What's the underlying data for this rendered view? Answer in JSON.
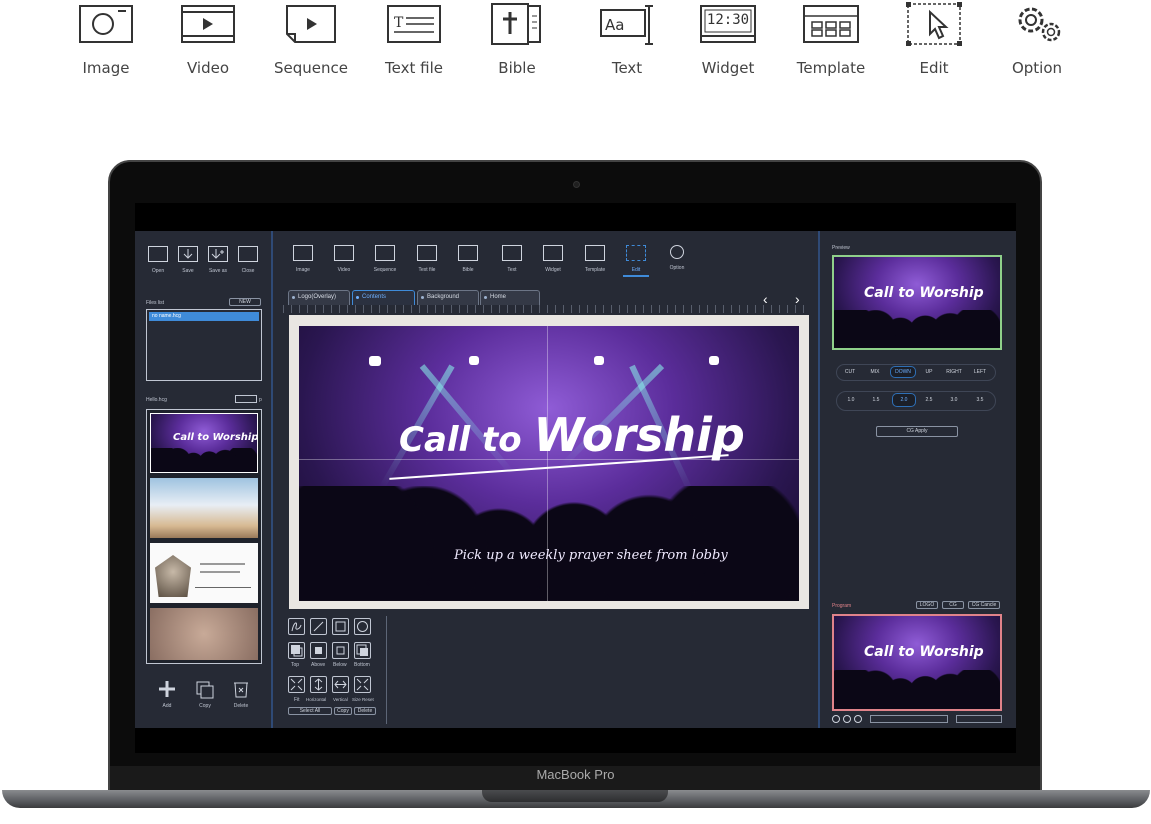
{
  "features": [
    {
      "label": "Image",
      "icon": "image-icon"
    },
    {
      "label": "Video",
      "icon": "video-icon"
    },
    {
      "label": "Sequence",
      "icon": "sequence-icon"
    },
    {
      "label": "Text file",
      "icon": "text-file-icon"
    },
    {
      "label": "Bible",
      "icon": "bible-icon"
    },
    {
      "label": "Text",
      "icon": "text-icon"
    },
    {
      "label": "Widget",
      "icon": "widget-icon",
      "clock": "12:30"
    },
    {
      "label": "Template",
      "icon": "template-icon"
    },
    {
      "label": "Edit",
      "icon": "edit-icon"
    },
    {
      "label": "Option",
      "icon": "option-icon"
    }
  ],
  "laptop": {
    "brand": "MacBook Pro"
  },
  "app": {
    "file_toolbar": [
      {
        "label": "Open"
      },
      {
        "label": "Save"
      },
      {
        "label": "Save as"
      },
      {
        "label": "Close"
      }
    ],
    "files_list": {
      "title": "Files list",
      "new_button": "NEW",
      "selected_file": "no name.hcg"
    },
    "current_file": {
      "name": "Hello.hcg",
      "page_suffix": "p"
    },
    "slide_actions": [
      {
        "label": "Add"
      },
      {
        "label": "Copy"
      },
      {
        "label": "Delete"
      }
    ],
    "main_toolbar": [
      {
        "label": "Image"
      },
      {
        "label": "Video"
      },
      {
        "label": "Sequence"
      },
      {
        "label": "Text file"
      },
      {
        "label": "Bible"
      },
      {
        "label": "Text"
      },
      {
        "label": "Widget"
      },
      {
        "label": "Template"
      },
      {
        "label": "Edit"
      },
      {
        "label": "Option"
      }
    ],
    "active_tool": "Edit",
    "tabs": [
      {
        "label": "Logo(Overlay)",
        "active": false
      },
      {
        "label": "Contents",
        "active": true
      },
      {
        "label": "Background",
        "active": false
      },
      {
        "label": "Home",
        "active": false
      }
    ],
    "slide": {
      "title_part1": "Call to",
      "title_part2": "Worship",
      "subtitle": "Pick up a weekly prayer sheet from lobby"
    },
    "arrange_buttons": [
      {
        "label": "Top"
      },
      {
        "label": "Above"
      },
      {
        "label": "Below"
      },
      {
        "label": "Bottom"
      }
    ],
    "transform_buttons": [
      {
        "label": "Fit"
      },
      {
        "label": "Horizontal"
      },
      {
        "label": "Vertical"
      },
      {
        "label": "Size Reset"
      }
    ],
    "edit_actions": [
      {
        "label": "Select All"
      },
      {
        "label": "Copy"
      },
      {
        "label": "Delete"
      }
    ],
    "preview": {
      "title": "Preview",
      "transitions": [
        "CUT",
        "MIX",
        "DOWN",
        "UP",
        "RIGHT",
        "LEFT"
      ],
      "selected_transition": "DOWN",
      "speeds": [
        "1.0",
        "1.5",
        "2.0",
        "2.5",
        "3.0",
        "3.5"
      ],
      "selected_speed": "2.0",
      "apply_button": "CG Apply"
    },
    "program": {
      "title": "Program",
      "buttons": [
        "LOGO",
        "CG",
        "CG Cancle"
      ]
    }
  },
  "colors": {
    "accent": "#3f8bd9",
    "preview_border": "#8fd08a",
    "program_border": "#e0838a",
    "panel_bg": "#262a35"
  }
}
